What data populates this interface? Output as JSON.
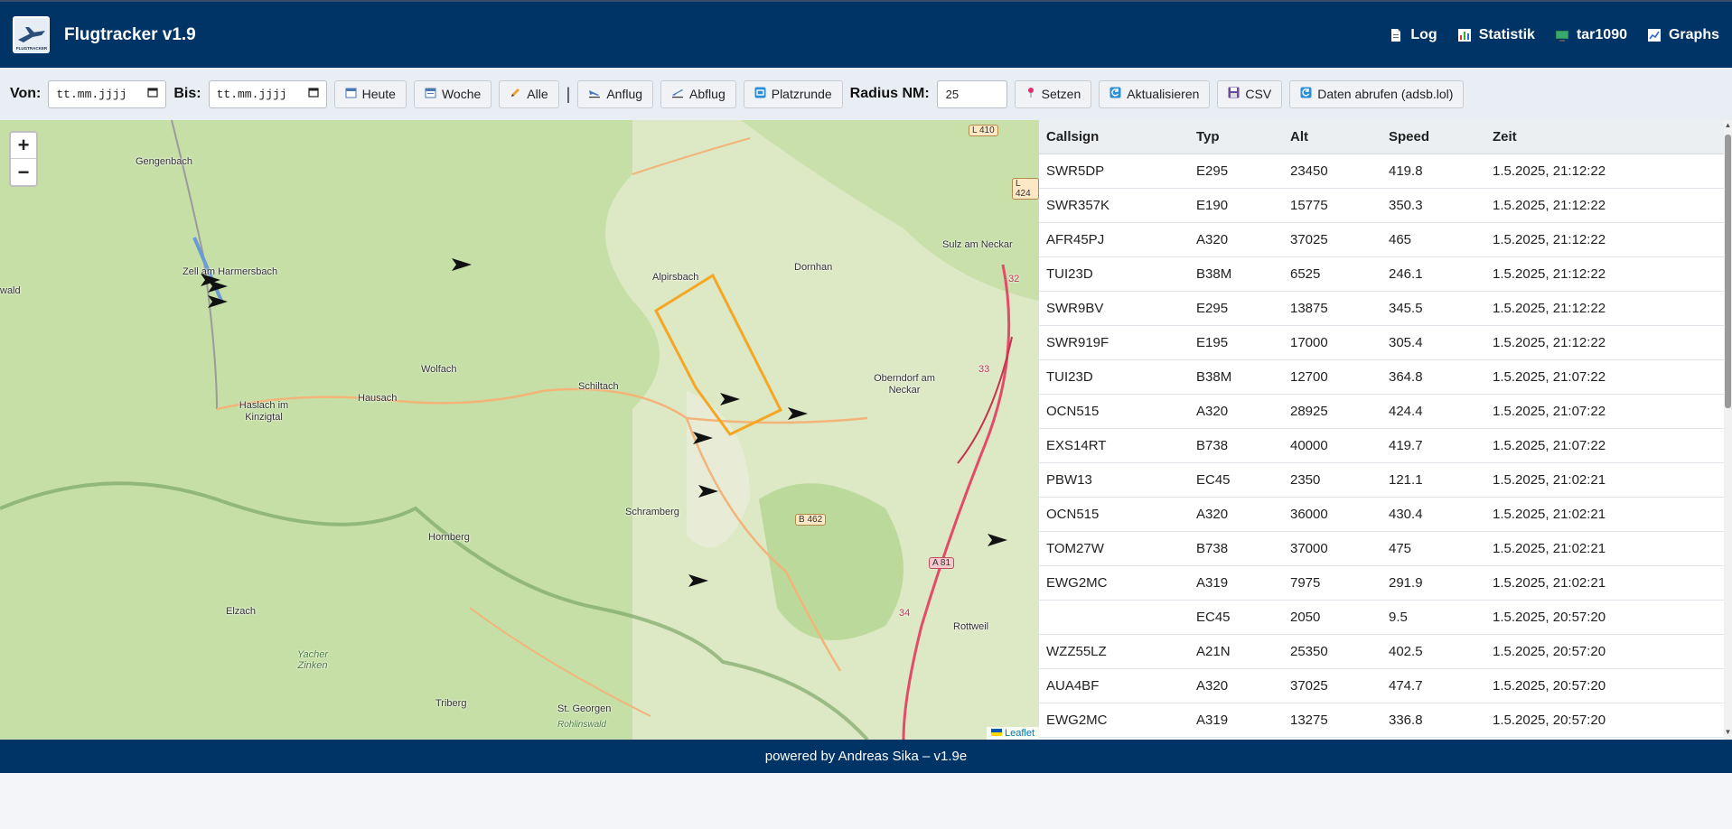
{
  "header": {
    "title": "Flugtracker v1.9",
    "logo_text": "FLUGTRACKER",
    "nav": [
      {
        "label": "Log",
        "icon": "document-icon"
      },
      {
        "label": "Statistik",
        "icon": "bar-chart-icon"
      },
      {
        "label": "tar1090",
        "icon": "monitor-icon"
      },
      {
        "label": "Graphs",
        "icon": "line-chart-icon"
      }
    ]
  },
  "toolbar": {
    "from_label": "Von:",
    "from_placeholder": "tt.mm.jjjj",
    "to_label": "Bis:",
    "to_placeholder": "tt.mm.jjjj",
    "today": "Heute",
    "week": "Woche",
    "all": "Alle",
    "separator": "|",
    "approach": "Anflug",
    "departure": "Abflug",
    "circuit": "Platzrunde",
    "radius_label": "Radius NM:",
    "radius_value": "25",
    "set": "Setzen",
    "refresh": "Aktualisieren",
    "csv": "CSV",
    "fetch": "Daten abrufen (adsb.lol)"
  },
  "map": {
    "zoom_in": "+",
    "zoom_out": "−",
    "attribution": "Leaflet",
    "places": [
      "Gengenbach",
      "Zell am Harmersbach",
      "wald",
      "Alpirsbach",
      "Dornhan",
      "Sulz am Neckar",
      "Wolfach",
      "Schiltach",
      "Oberndorf am Neckar",
      "Hausach",
      "Haslach im Kinzigtal",
      "Schramberg",
      "Hornberg",
      "Elzach",
      "Rottweil",
      "Triberg",
      "St. Georgen",
      "Yacher Zinken",
      "Rohlinswald"
    ],
    "roads": [
      "L 410",
      "L 424",
      "B 462",
      "A 81",
      "32",
      "33",
      "34"
    ]
  },
  "table": {
    "columns": [
      "Callsign",
      "Typ",
      "Alt",
      "Speed",
      "Zeit"
    ],
    "rows": [
      [
        "SWR5DP",
        "E295",
        "23450",
        "419.8",
        "1.5.2025, 21:12:22"
      ],
      [
        "SWR357K",
        "E190",
        "15775",
        "350.3",
        "1.5.2025, 21:12:22"
      ],
      [
        "AFR45PJ",
        "A320",
        "37025",
        "465",
        "1.5.2025, 21:12:22"
      ],
      [
        "TUI23D",
        "B38M",
        "6525",
        "246.1",
        "1.5.2025, 21:12:22"
      ],
      [
        "SWR9BV",
        "E295",
        "13875",
        "345.5",
        "1.5.2025, 21:12:22"
      ],
      [
        "SWR919F",
        "E195",
        "17000",
        "305.4",
        "1.5.2025, 21:12:22"
      ],
      [
        "TUI23D",
        "B38M",
        "12700",
        "364.8",
        "1.5.2025, 21:07:22"
      ],
      [
        "OCN515",
        "A320",
        "28925",
        "424.4",
        "1.5.2025, 21:07:22"
      ],
      [
        "EXS14RT",
        "B738",
        "40000",
        "419.7",
        "1.5.2025, 21:07:22"
      ],
      [
        "PBW13",
        "EC45",
        "2350",
        "121.1",
        "1.5.2025, 21:02:21"
      ],
      [
        "OCN515",
        "A320",
        "36000",
        "430.4",
        "1.5.2025, 21:02:21"
      ],
      [
        "TOM27W",
        "B738",
        "37000",
        "475",
        "1.5.2025, 21:02:21"
      ],
      [
        "EWG2MC",
        "A319",
        "7975",
        "291.9",
        "1.5.2025, 21:02:21"
      ],
      [
        "",
        "EC45",
        "2050",
        "9.5",
        "1.5.2025, 20:57:20"
      ],
      [
        "WZZ55LZ",
        "A21N",
        "25350",
        "402.5",
        "1.5.2025, 20:57:20"
      ],
      [
        "AUA4BF",
        "A320",
        "37025",
        "474.7",
        "1.5.2025, 20:57:20"
      ],
      [
        "EWG2MC",
        "A319",
        "13275",
        "336.8",
        "1.5.2025, 20:57:20"
      ]
    ]
  },
  "footer": {
    "text": "powered by Andreas Sika – v1.9e"
  },
  "colors": {
    "brand": "#003366",
    "polygon": "#f5a623",
    "toolbar_bg": "#e9eef4"
  }
}
